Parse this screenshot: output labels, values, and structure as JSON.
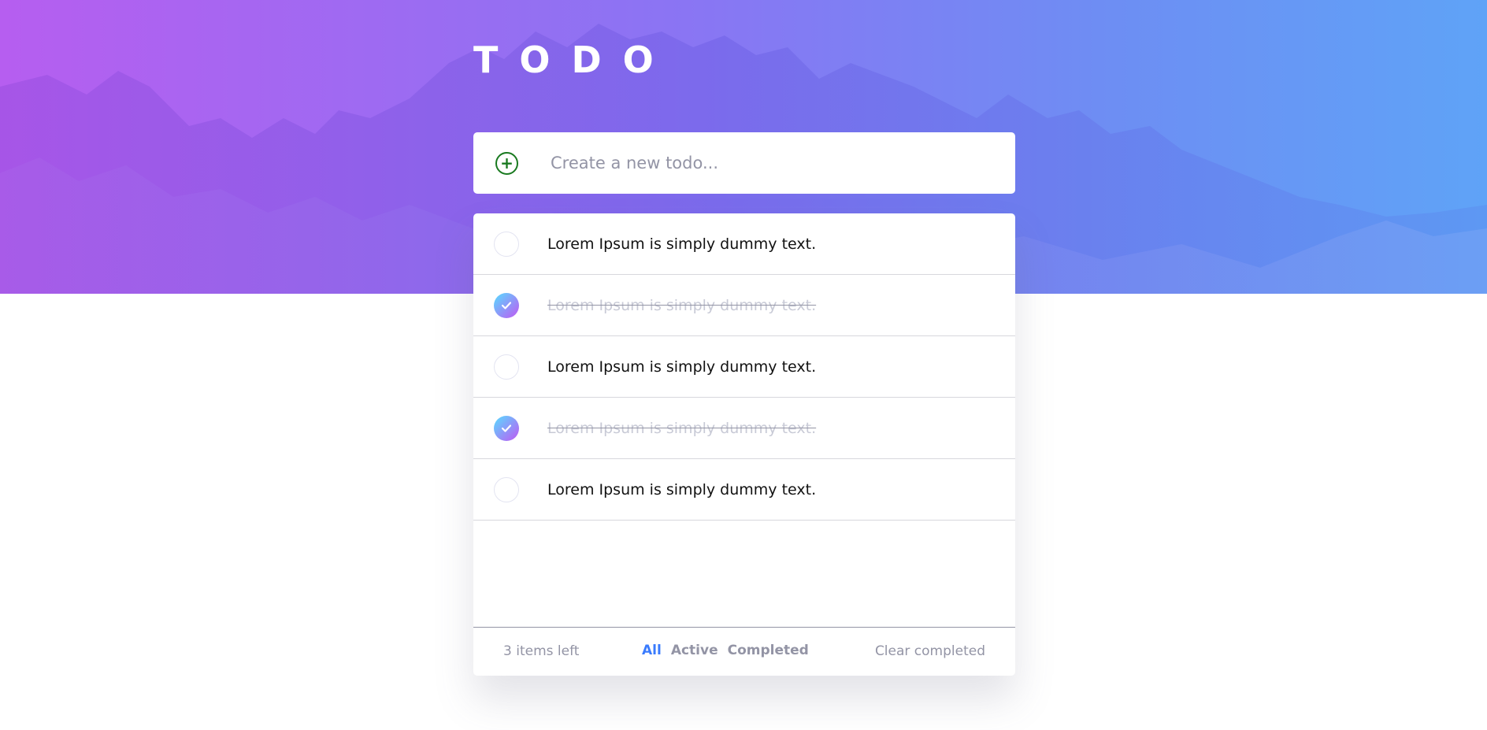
{
  "app": {
    "title": "TODO"
  },
  "new_todo": {
    "placeholder": "Create a new todo..."
  },
  "todos": [
    {
      "text": "Lorem Ipsum is simply dummy text.",
      "completed": false
    },
    {
      "text": "Lorem Ipsum is simply dummy text.",
      "completed": true
    },
    {
      "text": "Lorem Ipsum is simply dummy text.",
      "completed": false
    },
    {
      "text": "Lorem Ipsum is simply dummy text.",
      "completed": true
    },
    {
      "text": "Lorem Ipsum is simply dummy text.",
      "completed": false
    }
  ],
  "footer": {
    "items_left": "3 items left",
    "filters": [
      {
        "label": "All",
        "active": true
      },
      {
        "label": "Active",
        "active": false
      },
      {
        "label": "Completed",
        "active": false
      }
    ],
    "clear_label": "Clear completed"
  },
  "colors": {
    "accent": "#3a7bfd",
    "check_gradient_start": "#57ddff",
    "check_gradient_end": "#c058f3",
    "add_icon": "#1a7a20",
    "muted_text": "#9394a5"
  },
  "icons": {
    "add": "plus-circle-icon",
    "check": "checkmark-icon"
  }
}
